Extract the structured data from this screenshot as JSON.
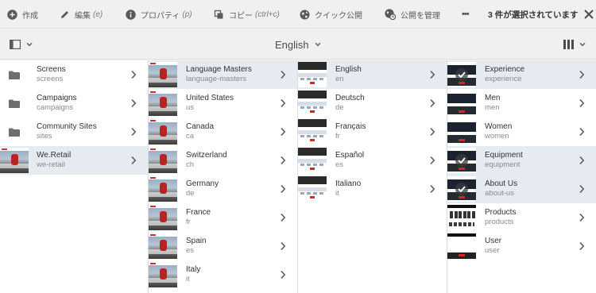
{
  "actionbar": {
    "create": "作成",
    "edit": "編集",
    "edit_shortcut": "(e)",
    "properties": "プロパティ",
    "properties_shortcut": "(p)",
    "copy": "コピー",
    "copy_shortcut": "(ctrl+c)",
    "quick_publish": "クイック公開",
    "manage_publication": "公開を管理",
    "more": "•••",
    "selection_count": "3 件が選択されています"
  },
  "toolbar": {
    "title": "English"
  },
  "columns": [
    {
      "items": [
        {
          "label": "Screens",
          "sub": "screens",
          "kind": "folder",
          "active": false,
          "selected": false
        },
        {
          "label": "Campaigns",
          "sub": "campaigns",
          "kind": "folder",
          "active": false,
          "selected": false
        },
        {
          "label": "Community Sites",
          "sub": "sites",
          "kind": "folder",
          "active": false,
          "selected": false
        },
        {
          "label": "We.Retail",
          "sub": "we-retail",
          "kind": "hero",
          "active": true,
          "selected": false
        }
      ]
    },
    {
      "items": [
        {
          "label": "Language Masters",
          "sub": "language-masters",
          "kind": "hero",
          "active": true,
          "selected": false
        },
        {
          "label": "United States",
          "sub": "us",
          "kind": "hero",
          "active": false,
          "selected": false
        },
        {
          "label": "Canada",
          "sub": "ca",
          "kind": "hero",
          "active": false,
          "selected": false
        },
        {
          "label": "Switzerland",
          "sub": "ch",
          "kind": "hero",
          "active": false,
          "selected": false
        },
        {
          "label": "Germany",
          "sub": "de",
          "kind": "hero",
          "active": false,
          "selected": false
        },
        {
          "label": "France",
          "sub": "fr",
          "kind": "hero",
          "active": false,
          "selected": false
        },
        {
          "label": "Spain",
          "sub": "es",
          "kind": "hero",
          "active": false,
          "selected": false
        },
        {
          "label": "Italy",
          "sub": "it",
          "kind": "hero",
          "active": false,
          "selected": false
        }
      ]
    },
    {
      "items": [
        {
          "label": "English",
          "sub": "en",
          "kind": "page",
          "active": true,
          "selected": false
        },
        {
          "label": "Deutsch",
          "sub": "de",
          "kind": "page",
          "active": false,
          "selected": false
        },
        {
          "label": "Français",
          "sub": "fr",
          "kind": "page",
          "active": false,
          "selected": false
        },
        {
          "label": "Español",
          "sub": "es",
          "kind": "page",
          "active": false,
          "selected": false
        },
        {
          "label": "Italiano",
          "sub": "it",
          "kind": "page",
          "active": false,
          "selected": false
        }
      ]
    },
    {
      "items": [
        {
          "label": "Experience",
          "sub": "experience",
          "kind": "dark",
          "active": true,
          "selected": true
        },
        {
          "label": "Men",
          "sub": "men",
          "kind": "dark",
          "active": false,
          "selected": false
        },
        {
          "label": "Women",
          "sub": "women",
          "kind": "dark",
          "active": false,
          "selected": false
        },
        {
          "label": "Equipment",
          "sub": "equipment",
          "kind": "dark",
          "active": true,
          "selected": true
        },
        {
          "label": "About Us",
          "sub": "about-us",
          "kind": "dark",
          "active": true,
          "selected": true
        },
        {
          "label": "Products",
          "sub": "products",
          "kind": "prod",
          "active": false,
          "selected": false
        },
        {
          "label": "User",
          "sub": "user",
          "kind": "user",
          "active": false,
          "selected": false
        }
      ]
    }
  ],
  "colors": {
    "active_row": "#e6ebf2",
    "toolbar_bg": "#f0f0f0",
    "icon": "#5a5a5a"
  },
  "icons": {
    "create": "plus-circle-icon",
    "edit": "pencil-icon",
    "properties": "info-circle-icon",
    "copy": "copy-icon",
    "quick_publish": "globe-icon",
    "manage_publication": "globe-clock-icon",
    "more": "more-icon",
    "close": "close-icon",
    "rail": "rail-toggle-icon",
    "view": "column-view-icon",
    "folder": "folder-icon",
    "chevron": "chevron-right-icon",
    "check": "check-circle-icon"
  }
}
